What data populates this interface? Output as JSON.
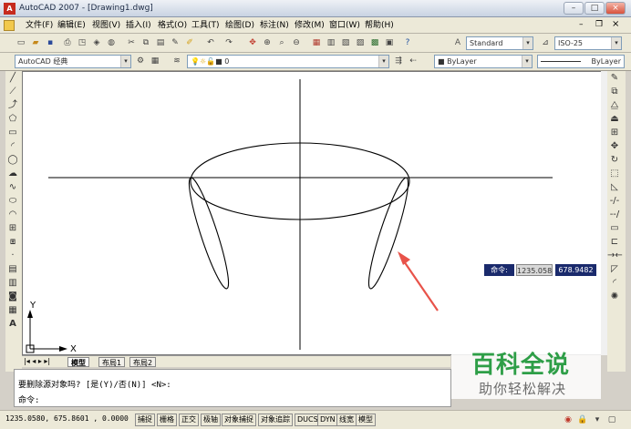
{
  "window": {
    "title": "AutoCAD 2007 - [Drawing1.dwg]",
    "app_badge": "A"
  },
  "menu": [
    "文件(F)",
    "编辑(E)",
    "视图(V)",
    "插入(I)",
    "格式(O)",
    "工具(T)",
    "绘图(D)",
    "标注(N)",
    "修改(M)",
    "窗口(W)",
    "帮助(H)"
  ],
  "toolbar": {
    "text_style": "Standard",
    "dim_style": "ISO-25",
    "workspace": "AutoCAD 经典",
    "layer": "0",
    "color": "ByLayer",
    "linetype": "ByLayer"
  },
  "tabs": [
    "模型",
    "布局1",
    "布局2"
  ],
  "command": {
    "line1": "要删除源对象吗? [是(Y)/否(N)] <N>:",
    "line2": "命令:"
  },
  "dynamic_input": {
    "label": "命令:",
    "x_value": "1235.058",
    "y_value": "678.9482"
  },
  "ucs": {
    "x_label": "X",
    "y_label": "Y"
  },
  "status": {
    "coords": "1235.0580, 675.8601 , 0.0000",
    "toggles": [
      "捕捉",
      "栅格",
      "正交",
      "极轴",
      "对象捕捉",
      "对象追踪",
      "DUCS",
      "DYN",
      "线宽",
      "模型"
    ]
  },
  "watermark": {
    "title": "百科全说",
    "subtitle": "助你轻松解决"
  },
  "colors": {
    "annotation_arrow": "#e8534a",
    "watermark_green": "#2e9e47",
    "dyn_box": "#1a2a6c"
  }
}
